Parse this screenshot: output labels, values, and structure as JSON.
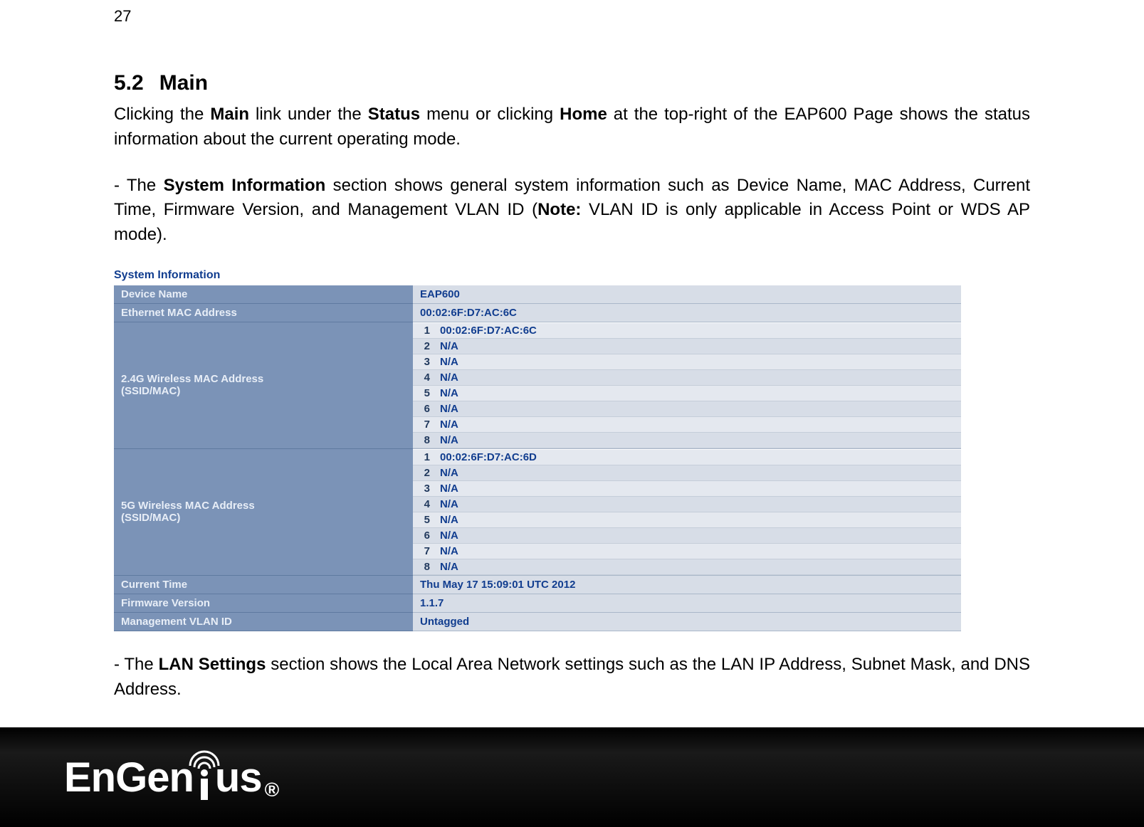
{
  "page_number": "27",
  "heading": {
    "num": "5.2",
    "title": "Main"
  },
  "para1": {
    "p1a": "Clicking the ",
    "b1": "Main",
    "p1b": " link under the ",
    "b2": "Status",
    "p1c": " menu or clicking ",
    "b3": "Home",
    "p1d": " at the top-right of the EAP600 Page shows the status information about the current operating mode."
  },
  "para2": {
    "p2a": "- The ",
    "b4": "System Information",
    "p2b": " section shows general system information such as Device Name, MAC Address, Current Time, Firmware Version, and Management VLAN ID (",
    "b5": "Note:",
    "p2c": " VLAN ID is only applicable in Access Point or WDS AP mode)."
  },
  "para3": {
    "p3a": "- The ",
    "b6": "LAN Settings",
    "p3b": " section shows the Local Area Network settings such as the LAN IP Address, Subnet Mask, and DNS Address."
  },
  "sysinfo": {
    "title": "System Information",
    "rows": {
      "device_name": {
        "label": "Device Name",
        "value": "EAP600"
      },
      "eth_mac": {
        "label": "Ethernet MAC Address",
        "value": "00:02:6F:D7:AC:6C"
      },
      "w24": {
        "label_l1": "2.4G Wireless MAC Address",
        "label_l2": "(SSID/MAC)",
        "items": [
          "00:02:6F:D7:AC:6C",
          "N/A",
          "N/A",
          "N/A",
          "N/A",
          "N/A",
          "N/A",
          "N/A"
        ]
      },
      "w5": {
        "label_l1": "5G Wireless MAC Address",
        "label_l2": "(SSID/MAC)",
        "items": [
          "00:02:6F:D7:AC:6D",
          "N/A",
          "N/A",
          "N/A",
          "N/A",
          "N/A",
          "N/A",
          "N/A"
        ]
      },
      "current_time": {
        "label": "Current Time",
        "value": "Thu May 17 15:09:01 UTC 2012"
      },
      "fw": {
        "label": "Firmware Version",
        "value": "1.1.7"
      },
      "vlan": {
        "label": "Management VLAN ID",
        "value": "Untagged"
      }
    }
  },
  "logo": {
    "part1": "EnGen",
    "part2": "us",
    "reg": "®"
  }
}
